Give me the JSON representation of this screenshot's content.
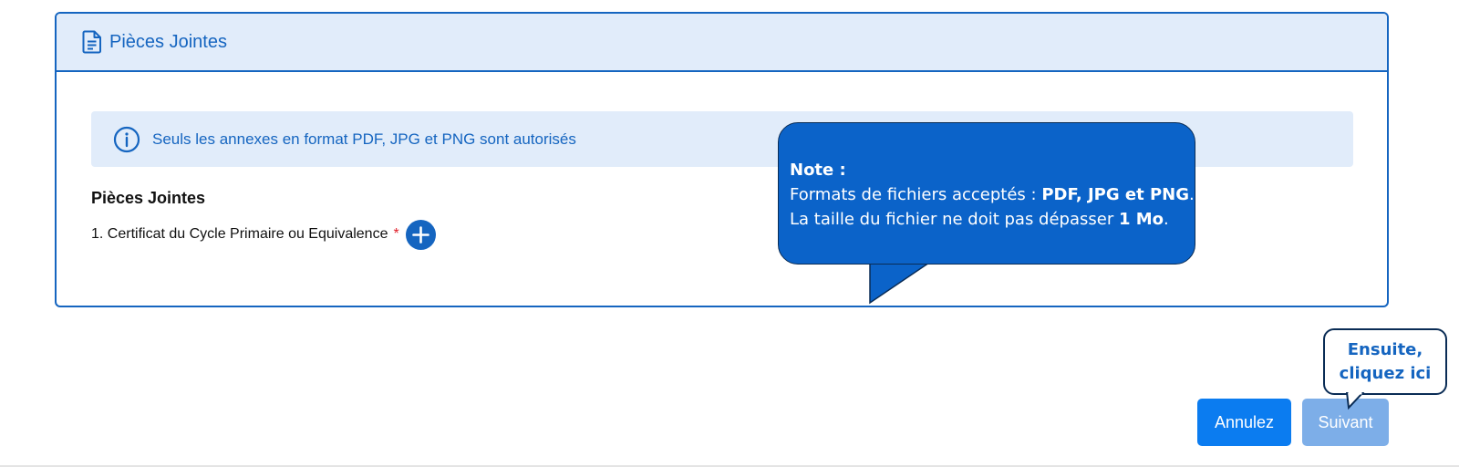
{
  "card": {
    "title": "Pièces Jointes",
    "icon": "document-icon"
  },
  "info": {
    "icon": "info-icon",
    "text": "Seuls les annexes en format PDF, JPG et PNG sont autorisés"
  },
  "attachments": {
    "section_label": "Pièces Jointes",
    "items": [
      {
        "label": "1. Certificat du Cycle Primaire ou Equivalence",
        "required_mark": "*",
        "add_icon": "plus-icon"
      }
    ]
  },
  "note": {
    "heading": "Note :",
    "line1_prefix": "Formats de fichiers acceptés : ",
    "line1_bold": "PDF, JPG et PNG",
    "line1_suffix": ".",
    "line2_prefix": "La taille du fichier ne doit pas dépasser ",
    "line2_bold": "1 Mo",
    "line2_suffix": "."
  },
  "hint": {
    "line1": "Ensuite,",
    "line2": "cliquez ici"
  },
  "actions": {
    "cancel_label": "Annulez",
    "next_label": "Suivant"
  },
  "colors": {
    "primary": "#1565c0",
    "header_bg": "#e1ecfa",
    "cancel_button": "#0b7cf0",
    "next_button_disabled": "#7daee8",
    "note_bg": "#0b63c9",
    "required": "#e0202a"
  }
}
